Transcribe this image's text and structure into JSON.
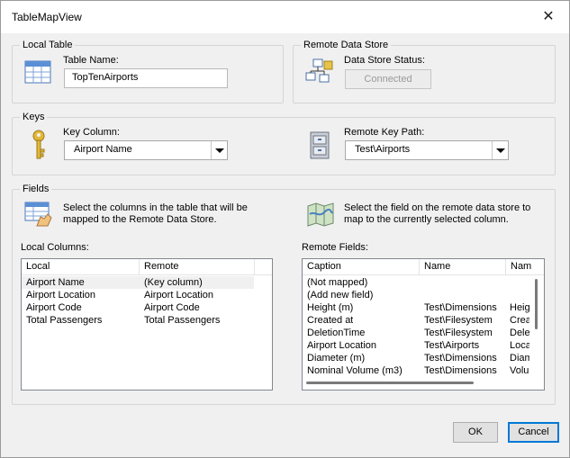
{
  "window": {
    "title": "TableMapView",
    "close_glyph": "✕"
  },
  "local_table": {
    "group_label": "Local Table",
    "table_name_label": "Table Name:",
    "table_name_value": "TopTenAirports",
    "icon": "table-grid-icon"
  },
  "remote_store": {
    "group_label": "Remote Data Store",
    "status_label": "Data Store Status:",
    "status_button": "Connected",
    "icon": "network-diagram-icon"
  },
  "keys": {
    "group_label": "Keys",
    "key_column_label": "Key Column:",
    "key_column_value": "Airport Name",
    "remote_key_label": "Remote Key Path:",
    "remote_key_value": "Test\\Airports",
    "key_icon": "key-icon",
    "cabinet_icon": "file-cabinet-icon"
  },
  "fields": {
    "group_label": "Fields",
    "local_desc": "Select the columns in the table that will be mapped to the Remote Data Store.",
    "remote_desc": "Select the field on the remote data store to map to the currently selected column.",
    "local_columns_label": "Local Columns:",
    "remote_fields_label": "Remote Fields:",
    "local_headers": [
      "Local",
      "Remote"
    ],
    "local_rows": [
      [
        "Airport Name",
        "(Key column)"
      ],
      [
        "Airport Location",
        "Airport Location"
      ],
      [
        "Airport Code",
        "Airport Code"
      ],
      [
        "Total Passengers",
        "Total Passengers"
      ]
    ],
    "remote_headers": [
      "Caption",
      "Name",
      "Nam"
    ],
    "remote_rows": [
      [
        "(Not mapped)",
        "",
        ""
      ],
      [
        "(Add new field)",
        "",
        ""
      ],
      [
        "Height (m)",
        "Test\\Dimensions",
        "Heig"
      ],
      [
        "Created at",
        "Test\\Filesystem",
        "Crea"
      ],
      [
        "DeletionTime",
        "Test\\Filesystem",
        "Dele"
      ],
      [
        "Airport Location",
        "Test\\Airports",
        "Loca"
      ],
      [
        "Diameter (m)",
        "Test\\Dimensions",
        "Diam"
      ],
      [
        "Nominal Volume (m3)",
        "Test\\Dimensions",
        "Volu"
      ]
    ]
  },
  "buttons": {
    "ok": "OK",
    "cancel": "Cancel"
  }
}
